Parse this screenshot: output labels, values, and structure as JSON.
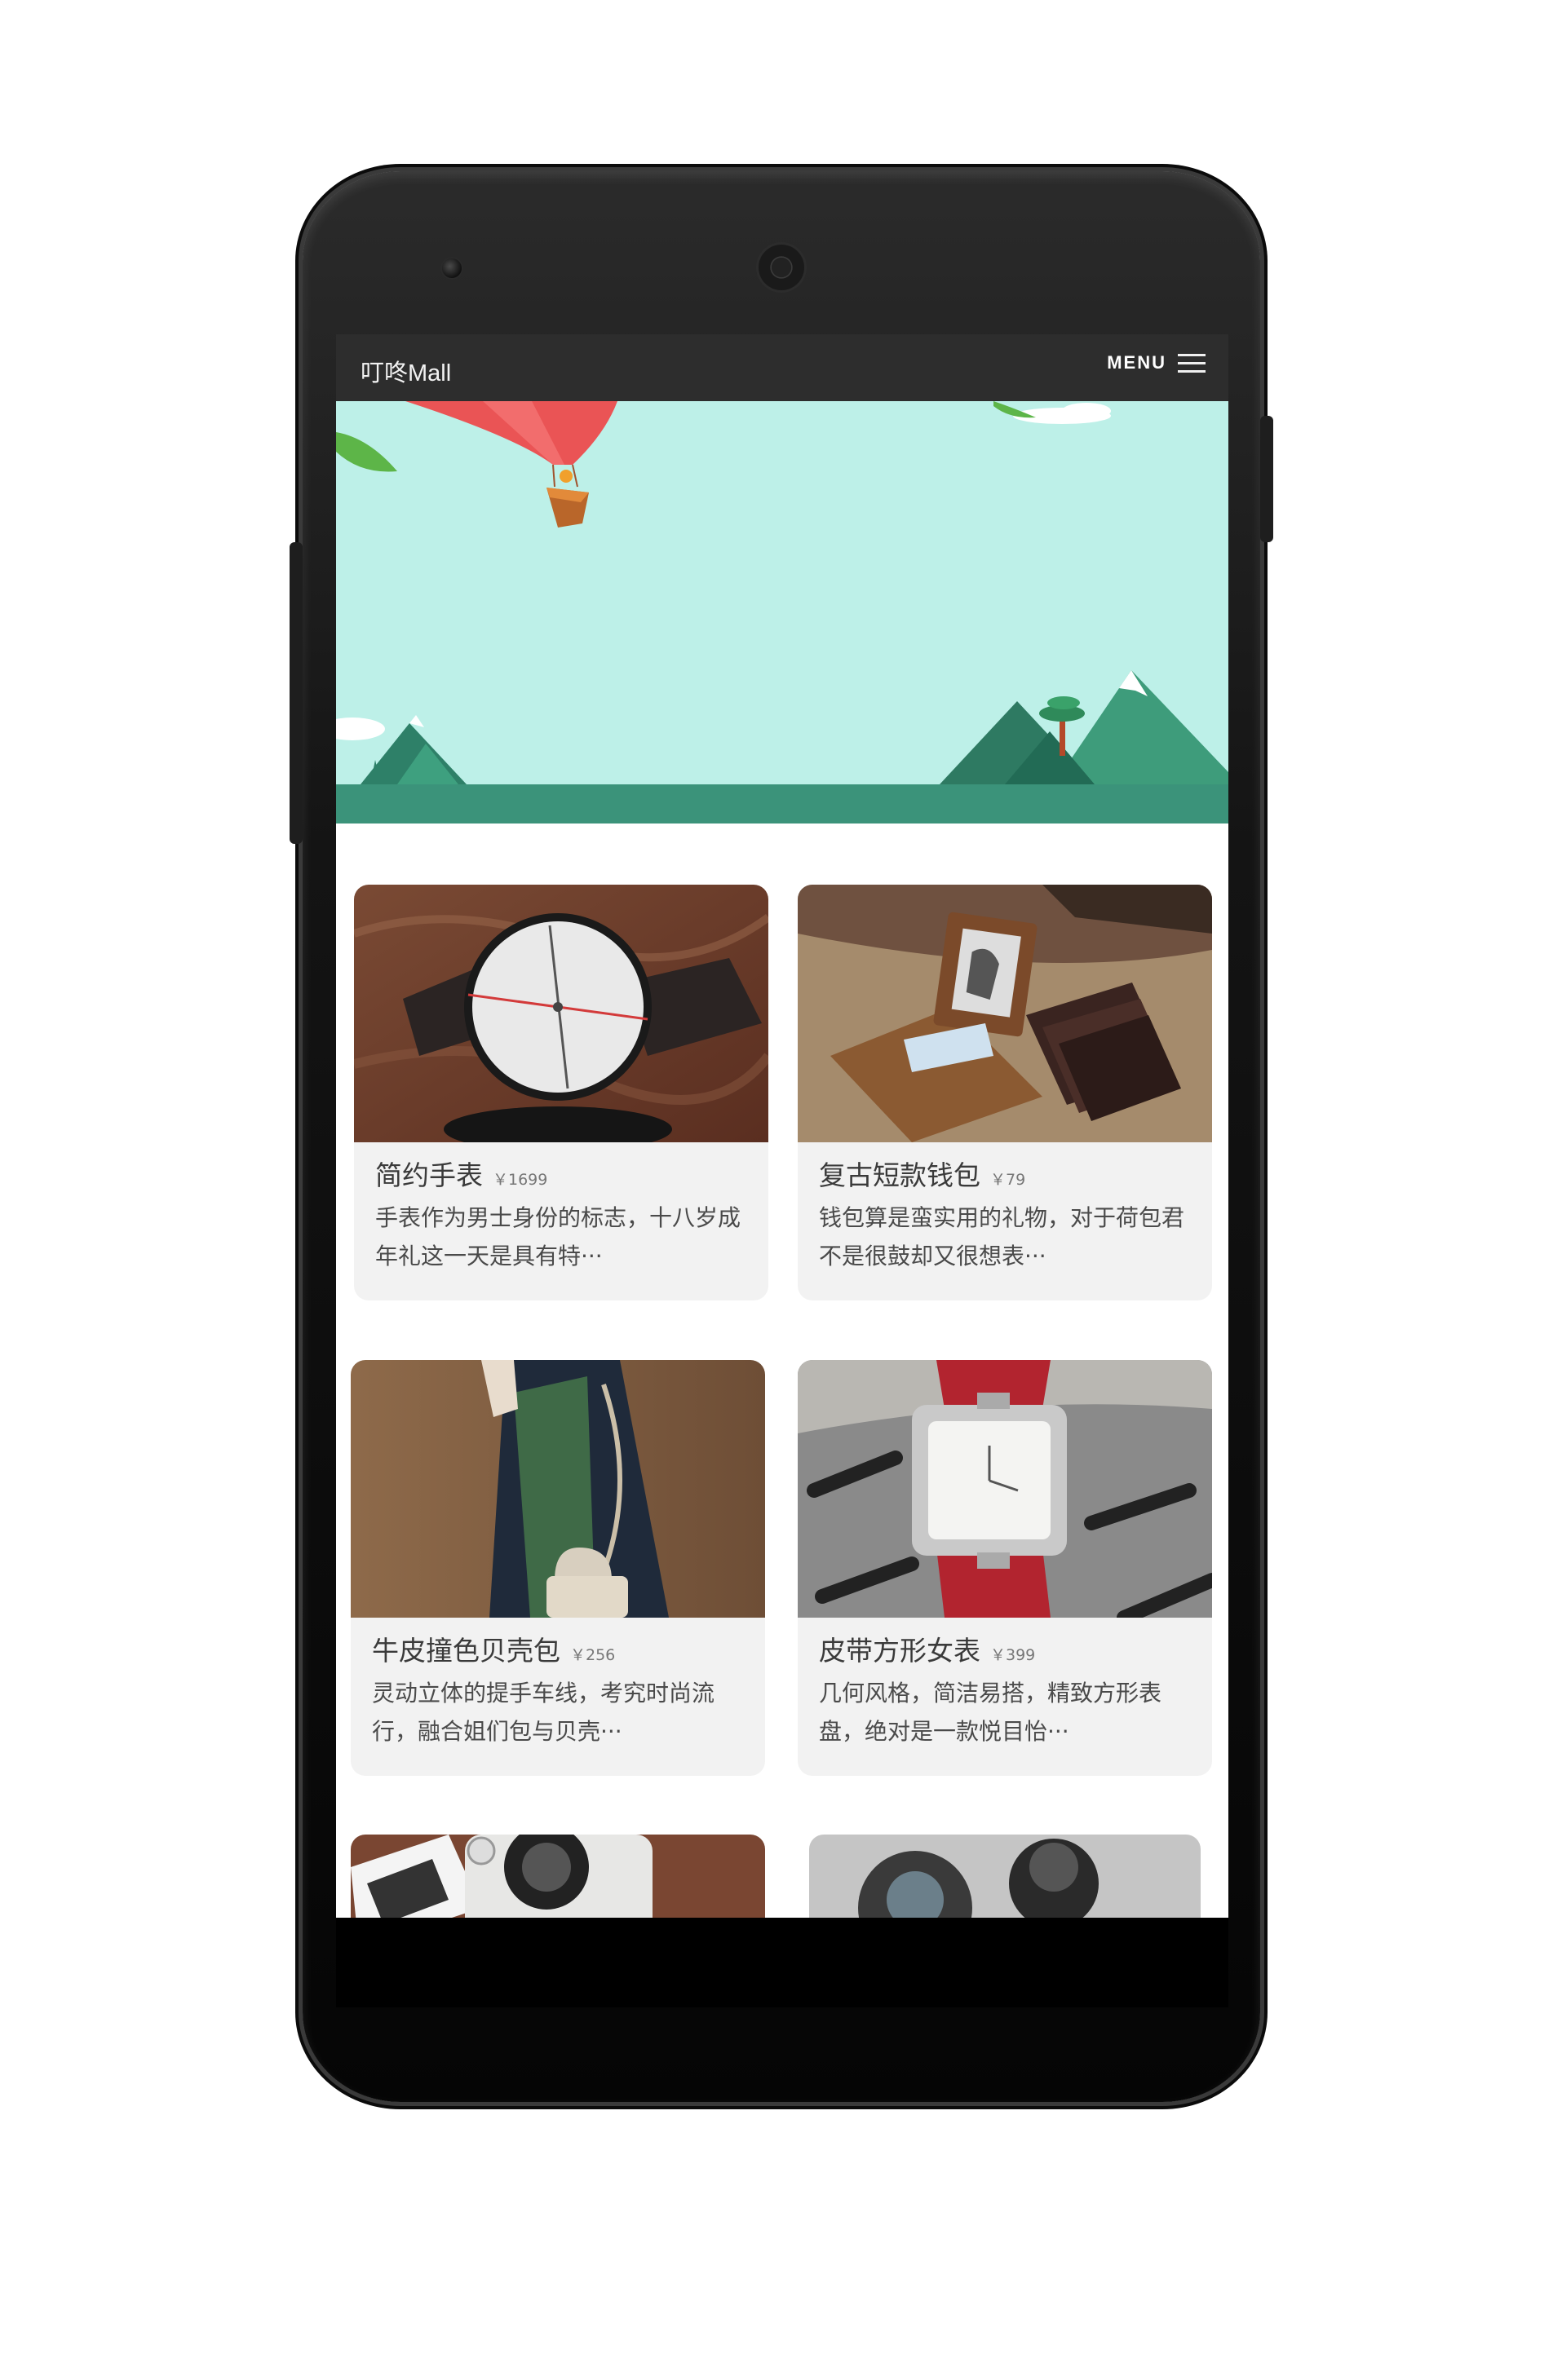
{
  "app": {
    "brand": "叮咚Mall",
    "menu_label": "MENU"
  },
  "icons": {
    "menu": "hamburger-menu-icon"
  },
  "colors": {
    "topbar": "#2d2d2d",
    "banner_sky": "#bdf0e8",
    "banner_ground": "#3b937a",
    "card_bg": "#f2f2f2"
  },
  "products": [
    {
      "name": "简约手表",
      "price": "￥1699",
      "desc": "手表作为男士身份的标志，十八岁成年礼这一天是具有特···"
    },
    {
      "name": "复古短款钱包",
      "price": "￥79",
      "desc": "钱包算是蛮实用的礼物，对于荷包君不是很鼓却又很想表···"
    },
    {
      "name": "牛皮撞色贝壳包",
      "price": "￥256",
      "desc": "灵动立体的提手车线，考究时尚流行，融合姐们包与贝壳···"
    },
    {
      "name": "皮带方形女表",
      "price": "￥399",
      "desc": "几何风格，简洁易搭，精致方形表盘，绝对是一款悦目怡···"
    }
  ]
}
